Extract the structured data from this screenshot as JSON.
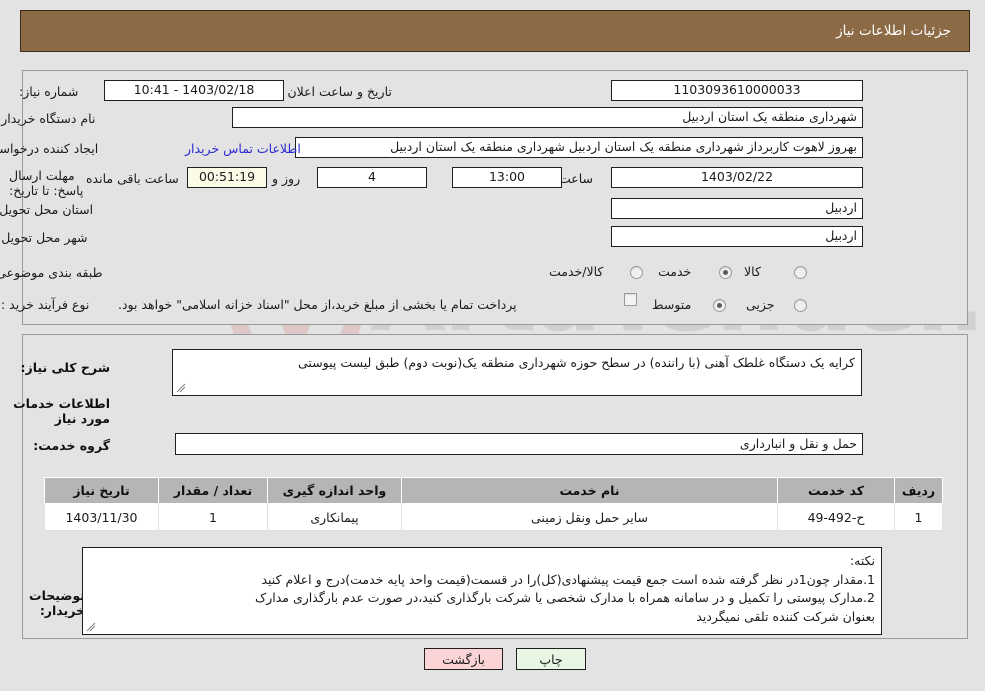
{
  "header": {
    "title": "جزئیات اطلاعات نیاز"
  },
  "form": {
    "need_number_label": "شماره نیاز:",
    "need_number_value": "1103093610000033",
    "announce_datetime_label": "تاریخ و ساعت اعلان عمومی:",
    "announce_datetime_value": "1403/02/18 - 10:41",
    "buyer_org_label": "نام دستگاه خریدار:",
    "buyer_org_value": "شهرداری منطقه یک استان اردبیل",
    "buyer_org_value2": "شهرداری منطقه یک استان اردبیل",
    "requester_label": "ایجاد کننده درخواست:",
    "requester_value": "بهروز لاهوت کاربرداز شهرداری منطقه یک استان اردبیل شهرداری منطقه یک استان اردبیل",
    "contact_link": "اطلاعات تماس خریدار",
    "deadline_label": "مهلت ارسال پاسخ: تا تاریخ:",
    "deadline_date": "1403/02/22",
    "time_label": "ساعت",
    "deadline_time": "13:00",
    "days_remaining": "4",
    "days_word": "روز و",
    "hours_remaining": "00:51:19",
    "hours_word": "ساعت باقی مانده",
    "province_label": "استان محل تحویل:",
    "province_value": "اردبیل",
    "city_label": "شهر محل تحویل:",
    "city_value": "اردبیل",
    "category_label": "طبقه بندی موضوعی:",
    "category_options": [
      "کالا",
      "خدمت",
      "کالا/خدمت"
    ],
    "category_selected": "خدمت",
    "process_label": "نوع فرآیند خرید :",
    "process_options": [
      "جزیی",
      "متوسط"
    ],
    "process_selected": "متوسط",
    "payment_note": "پرداخت تمام یا بخشی از مبلغ خرید،از محل \"اسناد خزانه اسلامی\" خواهد بود."
  },
  "description": {
    "need_summary_label": "شرح کلی نیاز:",
    "need_summary_value": "کرایه یک دستگاه غلطک آهنی (با راننده) در سطح حوزه شهرداری منطقه یک(نوبت دوم) طبق لیست پیوستی",
    "services_section_title": "اطلاعات خدمات مورد نیاز",
    "service_group_label": "گروه خدمت:",
    "service_group_value": "حمل و نقل و انبارداری"
  },
  "table": {
    "columns": [
      "ردیف",
      "کد خدمت",
      "نام خدمت",
      "واحد اندازه گیری",
      "تعداد / مقدار",
      "تاریخ نیاز"
    ],
    "rows": [
      {
        "radif": "1",
        "code": "ح-492-49",
        "name": "سایر حمل ونقل زمینی",
        "unit": "پیمانکاری",
        "qty": "1",
        "date": "1403/11/30"
      }
    ]
  },
  "buyer_notes": {
    "label": "توضیحات خریدار:",
    "line0": "نکته:",
    "line1": "1.مقدار چون1در نظر گرفته شده است جمع قیمت پیشنهادی(کل)را در قسمت(قیمت واحد پایه خدمت)درج و اعلام کنید",
    "line2": "2.مدارک پیوستی را تکمیل و در سامانه همراه با مدارک شخصی یا شرکت بارگذاری کنید،در صورت عدم بارگذاری مدارک",
    "line3": "بعنوان شرکت کننده تلقی نمیگردید"
  },
  "buttons": {
    "print": "چاپ",
    "back": "بازگشت"
  },
  "watermark": {
    "text": "ArtaTender.net"
  },
  "colors": {
    "header_bg": "#8b6a45",
    "page_bg": "#e3e3e3",
    "link": "#2a2ad0",
    "table_header_bg": "#b5b5b5",
    "print_btn_bg": "#e8f6e4",
    "back_btn_bg": "#fbd5d5",
    "countdown_bg": "#fbfbe8"
  }
}
